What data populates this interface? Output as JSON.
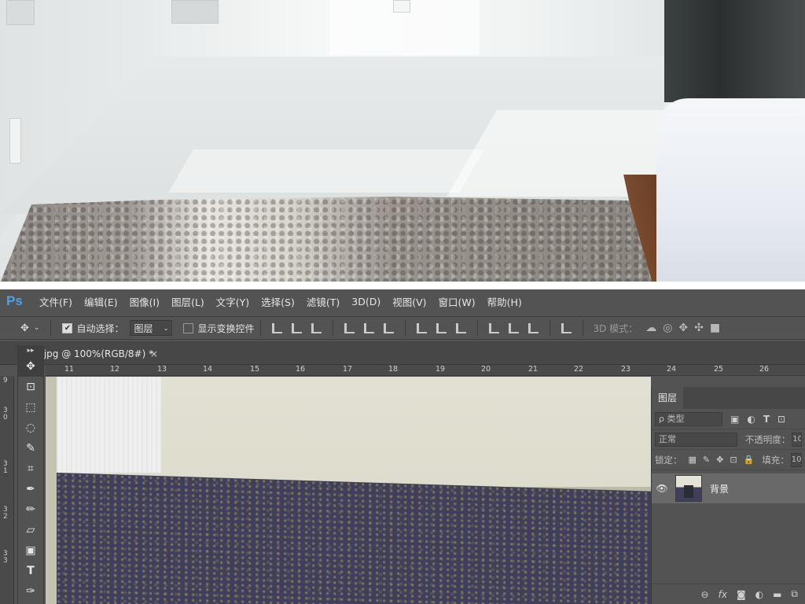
{
  "app": {
    "logo": "Ps"
  },
  "menu": [
    "文件(F)",
    "编辑(E)",
    "图像(I)",
    "图层(L)",
    "文字(Y)",
    "选择(S)",
    "滤镜(T)",
    "3D(D)",
    "视图(V)",
    "窗口(W)",
    "帮助(H)"
  ],
  "options": {
    "move_icon": "move-icon",
    "auto_select_label": "自动选择：",
    "auto_select_checked": true,
    "target_value": "图层",
    "show_transform_label": "显示变换控件",
    "show_transform_checked": false,
    "mode_label": "3D 模式："
  },
  "document": {
    "tab_title": ".jpg @ 100%(RGB/8#) *",
    "close_glyph": "×",
    "toolbox_header": "▸▸"
  },
  "ruler": {
    "horizontal": [
      "11",
      "12",
      "13",
      "14",
      "15",
      "16",
      "17",
      "18",
      "19",
      "20",
      "21",
      "22",
      "23",
      "24",
      "25",
      "26"
    ],
    "vertical": [
      "3\n0",
      "3\n1",
      "3\n2",
      "3\n3"
    ],
    "corner": "9"
  },
  "tools": [
    "move",
    "artboard",
    "marquee",
    "lasso",
    "quick-select",
    "crop",
    "eyedropper",
    "brush",
    "eraser",
    "gradient",
    "type",
    "pen"
  ],
  "layers_panel": {
    "tab_label": "图层",
    "kind_filter": "ρ 类型",
    "blend_mode": "正常",
    "opacity_label": "不透明度：",
    "opacity_value": "10",
    "lock_label": "锁定：",
    "fill_label": "填充：",
    "fill_value": "10",
    "layers": [
      {
        "name": "背景",
        "visible": true
      }
    ]
  },
  "colors": {
    "ps_blue": "#4aa3f0",
    "chrome": "#535353",
    "panel_dark": "#474747"
  }
}
